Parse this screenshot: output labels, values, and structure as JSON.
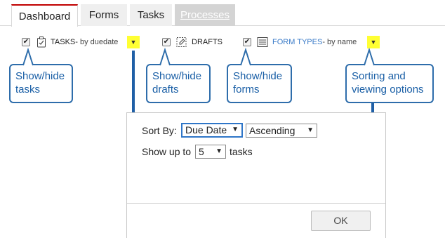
{
  "tabs": [
    {
      "label": "Dashboard",
      "state": "active"
    },
    {
      "label": "Forms",
      "state": "normal"
    },
    {
      "label": "Tasks",
      "state": "normal"
    },
    {
      "label": "Processes",
      "state": "disabled"
    }
  ],
  "toolbar": {
    "tasks": {
      "label": "TASKS-",
      "sort": " by duedate",
      "checked": true,
      "dropdown_glyph": "▼"
    },
    "drafts": {
      "label": "DRAFTS",
      "checked": true
    },
    "forms": {
      "label": "FORM TYPES",
      "sort": "- by name",
      "checked": true,
      "dropdown_glyph": "▼"
    }
  },
  "callouts": {
    "tasks": [
      "Show/hide",
      "tasks"
    ],
    "drafts": [
      "Show/hide",
      "drafts"
    ],
    "forms": [
      "Show/hide",
      "forms"
    ],
    "options": [
      "Sorting and",
      "viewing options"
    ]
  },
  "dialog": {
    "sort_label": "Sort By:",
    "sort_field": "Due Date",
    "sort_order": "Ascending",
    "show_prefix": "Show up to",
    "show_count": "5",
    "show_suffix": "tasks",
    "ok_label": "OK"
  },
  "colors": {
    "accent_red": "#c00000",
    "callout_blue": "#2e6dab",
    "highlight_yellow": "#ffff33",
    "link_blue": "#3a7bc8"
  }
}
